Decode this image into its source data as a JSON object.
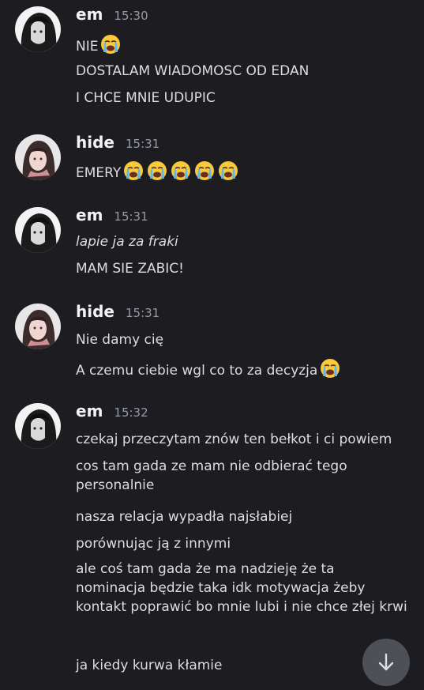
{
  "messages": [
    {
      "author": "em",
      "time": "15:30",
      "avatar": "em-avatar",
      "lines": [
        {
          "text": "NIE",
          "emoji_count": 1
        },
        {
          "text": "DOSTALAM WIADOMOSC OD EDAN",
          "emoji_count": 0
        },
        {
          "text": "I CHCE MNIE UDUPIC",
          "emoji_count": 0
        }
      ]
    },
    {
      "author": "hide",
      "time": "15:31",
      "avatar": "hide-avatar",
      "lines": [
        {
          "text": "EMERY",
          "emoji_count": 5
        }
      ]
    },
    {
      "author": "em",
      "time": "15:31",
      "avatar": "em-avatar",
      "lines": [
        {
          "text": "lapie ja za fraki",
          "italic": true,
          "emoji_count": 0
        },
        {
          "text": "MAM SIE ZABIC!",
          "emoji_count": 0
        }
      ]
    },
    {
      "author": "hide",
      "time": "15:31",
      "avatar": "hide-avatar",
      "lines": [
        {
          "text": "Nie damy cię",
          "emoji_count": 0
        },
        {
          "text": "A czemu ciebie wgl co to za decyzja",
          "emoji_count": 1
        }
      ]
    },
    {
      "author": "em",
      "time": "15:32",
      "avatar": "em-avatar",
      "lines": [
        {
          "text": "czekaj przeczytam znów ten bełkot i ci powiem",
          "emoji_count": 0
        },
        {
          "text": "cos tam gada ze mam nie odbierać tego personalnie",
          "emoji_count": 0
        },
        {
          "text": "nasza relacja wypadła najsłabiej",
          "emoji_count": 0
        },
        {
          "text": "porównując ją z innymi",
          "emoji_count": 0
        },
        {
          "text": "ale coś tam gada że ma nadzieję że ta nominacja będzie taka idk motywacja żeby kontakt poprawić bo mnie lubi i nie chce złej krwi",
          "emoji_count": 0
        },
        {
          "text": "ja kiedy kurwa kłamie",
          "emoji_count": 0
        }
      ]
    }
  ],
  "emoji_name": "loudly-crying-face",
  "scroll_button_icon": "arrow-down-icon",
  "colors": {
    "background": "#1c1c21",
    "text": "#dbdee1",
    "author": "#f2f3f5",
    "timestamp": "#949ba4",
    "scroll_button": "#4e5058"
  }
}
